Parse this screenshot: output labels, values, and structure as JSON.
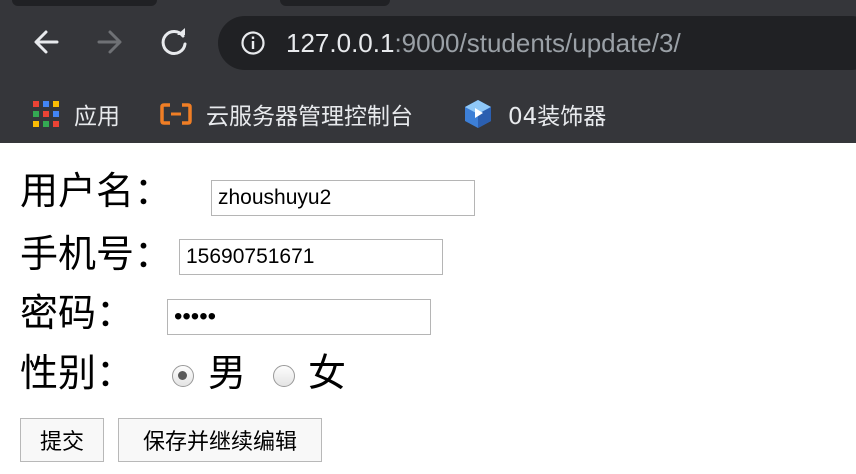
{
  "browser": {
    "url_host": "127.0.0.1",
    "url_rest": ":9000/students/update/3/",
    "bookmarks": [
      {
        "label": "应用",
        "icon": "apps-grid-icon"
      },
      {
        "label": "云服务器管理控制台",
        "icon": "aliyun-icon"
      },
      {
        "label": "04装饰器",
        "icon": "bookmark-cube-icon"
      }
    ]
  },
  "form": {
    "username_label": "用户名：",
    "username_value": "zhoushuyu2",
    "phone_label": "手机号：",
    "phone_value": "15690751671",
    "password_label": "密码：",
    "password_value": "12345",
    "gender_label": "性别：",
    "gender_male": "男",
    "gender_female": "女",
    "gender_selected": "男",
    "submit_label": "提交",
    "save_continue_label": "保存并继续编辑"
  },
  "colors": {
    "chrome_bg": "#35363a",
    "omnibox_bg": "#202124",
    "bookmark_accent": "#f07e25"
  }
}
